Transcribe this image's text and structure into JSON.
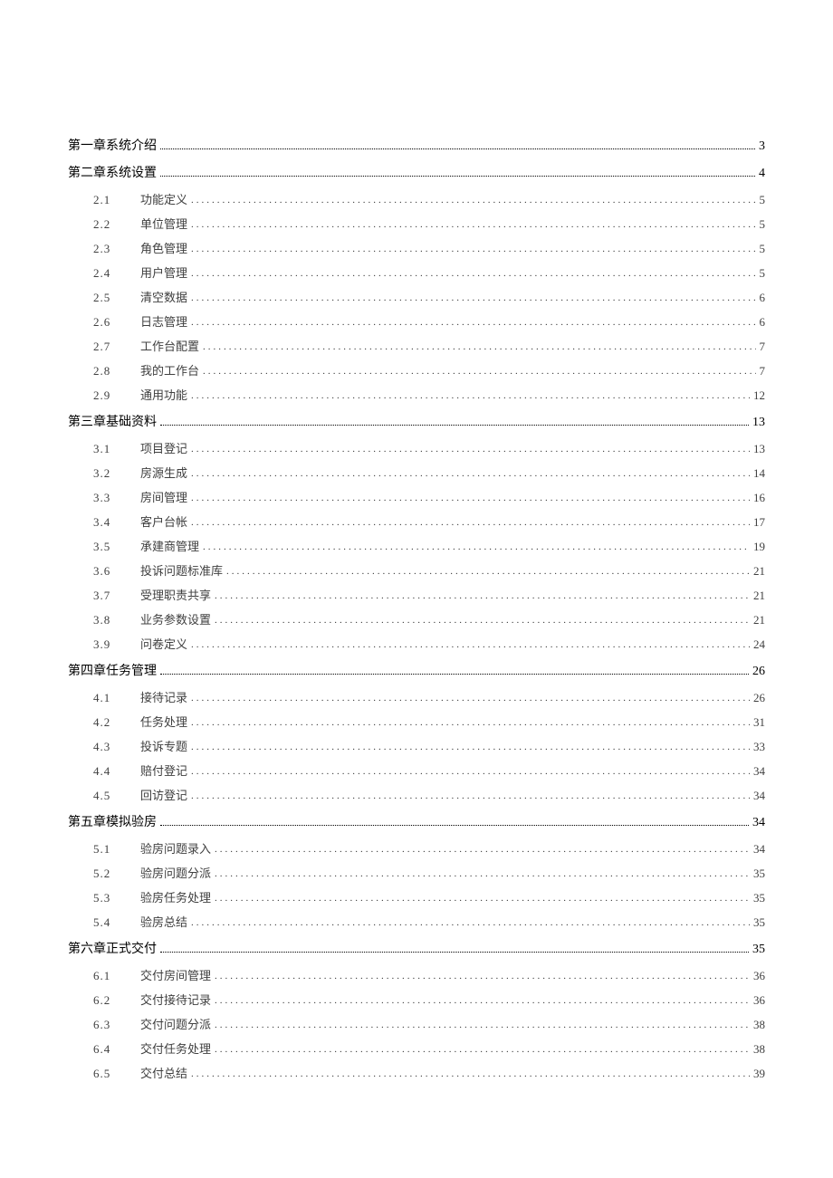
{
  "toc": [
    {
      "type": "chapter",
      "title": "第一章系统介绍",
      "page": "3"
    },
    {
      "type": "chapter",
      "title": "第二章系统设置",
      "page": "4"
    },
    {
      "type": "sub",
      "num": "2.1",
      "title": "功能定义",
      "page": "5"
    },
    {
      "type": "sub",
      "num": "2.2",
      "title": "单位管理",
      "page": "5"
    },
    {
      "type": "sub",
      "num": "2.3",
      "title": "角色管理",
      "page": "5"
    },
    {
      "type": "sub",
      "num": "2.4",
      "title": "用户管理",
      "page": "5"
    },
    {
      "type": "sub",
      "num": "2.5",
      "title": "清空数据",
      "page": "6"
    },
    {
      "type": "sub",
      "num": "2.6",
      "title": "日志管理",
      "page": "6"
    },
    {
      "type": "sub",
      "num": "2.7",
      "title": "工作台配置",
      "page": "7"
    },
    {
      "type": "sub",
      "num": "2.8",
      "title": "我的工作台",
      "page": "7"
    },
    {
      "type": "sub",
      "num": "2.9",
      "title": "通用功能",
      "page": "12"
    },
    {
      "type": "chapter",
      "title": "第三章基础资料",
      "page": "13"
    },
    {
      "type": "sub",
      "num": "3.1",
      "title": "项目登记",
      "page": "13"
    },
    {
      "type": "sub",
      "num": "3.2",
      "title": "房源生成",
      "page": "14"
    },
    {
      "type": "sub",
      "num": "3.3",
      "title": "房间管理",
      "page": "16"
    },
    {
      "type": "sub",
      "num": "3.4",
      "title": "客户台帐",
      "page": "17"
    },
    {
      "type": "sub",
      "num": "3.5",
      "title": "承建商管理",
      "page": "19"
    },
    {
      "type": "sub",
      "num": "3.6",
      "title": "投诉问题标准库",
      "page": "21"
    },
    {
      "type": "sub",
      "num": "3.7",
      "title": "受理职责共享",
      "page": "21"
    },
    {
      "type": "sub",
      "num": "3.8",
      "title": "业务参数设置",
      "page": "21"
    },
    {
      "type": "sub",
      "num": "3.9",
      "title": "问卷定义",
      "page": "24"
    },
    {
      "type": "chapter",
      "title": "第四章任务管理",
      "page": "26"
    },
    {
      "type": "sub",
      "num": "4.1",
      "title": "接待记录",
      "page": "26"
    },
    {
      "type": "sub",
      "num": "4.2",
      "title": "任务处理",
      "page": "31"
    },
    {
      "type": "sub",
      "num": "4.3",
      "title": "投诉专题",
      "page": "33"
    },
    {
      "type": "sub",
      "num": "4.4",
      "title": "赔付登记",
      "page": "34"
    },
    {
      "type": "sub",
      "num": "4.5",
      "title": "回访登记",
      "page": "34"
    },
    {
      "type": "chapter",
      "title": "第五章模拟验房",
      "page": "34"
    },
    {
      "type": "sub",
      "num": "5.1",
      "title": "验房问题录入",
      "page": "34"
    },
    {
      "type": "sub",
      "num": "5.2",
      "title": "验房问题分派",
      "page": "35"
    },
    {
      "type": "sub",
      "num": "5.3",
      "title": "验房任务处理",
      "page": "35"
    },
    {
      "type": "sub",
      "num": "5.4",
      "title": "验房总结",
      "page": "35"
    },
    {
      "type": "chapter",
      "title": "第六章正式交付",
      "page": "35"
    },
    {
      "type": "sub",
      "num": "6.1",
      "title": "交付房间管理",
      "page": "36"
    },
    {
      "type": "sub",
      "num": "6.2",
      "title": "交付接待记录",
      "page": "36"
    },
    {
      "type": "sub",
      "num": "6.3",
      "title": "交付问题分派",
      "page": "38"
    },
    {
      "type": "sub",
      "num": "6.4",
      "title": "交付任务处理",
      "page": "38"
    },
    {
      "type": "sub",
      "num": "6.5",
      "title": "交付总结",
      "page": "39"
    }
  ]
}
